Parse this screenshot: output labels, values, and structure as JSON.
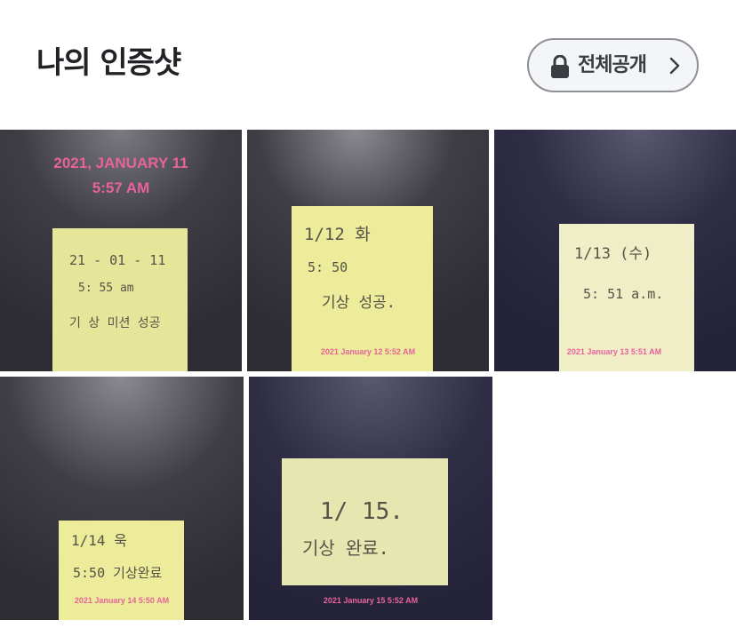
{
  "header": {
    "title": "나의 인증샷",
    "visibility_label": "전체공개"
  },
  "photos": [
    {
      "note_lines": [
        "21 - 01 - 11",
        "5: 55 am",
        "기 상  미션  성공"
      ],
      "stamp_lines": [
        "2021, JANUARY 11",
        "5:57 AM"
      ]
    },
    {
      "note_lines": [
        "1/12  화",
        "5: 50",
        "기상  성공."
      ],
      "stamp": "2021 January 12 5:52 AM"
    },
    {
      "note_lines": [
        "1/13 (수)",
        "5: 51 a.m."
      ],
      "stamp": "2021 January 13 5:51 AM"
    },
    {
      "note_lines": [
        "1/14  욱",
        "5:50  기상완료"
      ],
      "stamp": "2021 January 14 5:50 AM"
    },
    {
      "note_lines": [
        "1/ 15.",
        "기상  완료."
      ],
      "stamp": "2021 January 15 5:52 AM"
    }
  ],
  "colors": {
    "title": "#222226",
    "stamp_pink": "#e8629c",
    "note_yellow": "#ecec9a",
    "button_border": "#8e9096"
  }
}
